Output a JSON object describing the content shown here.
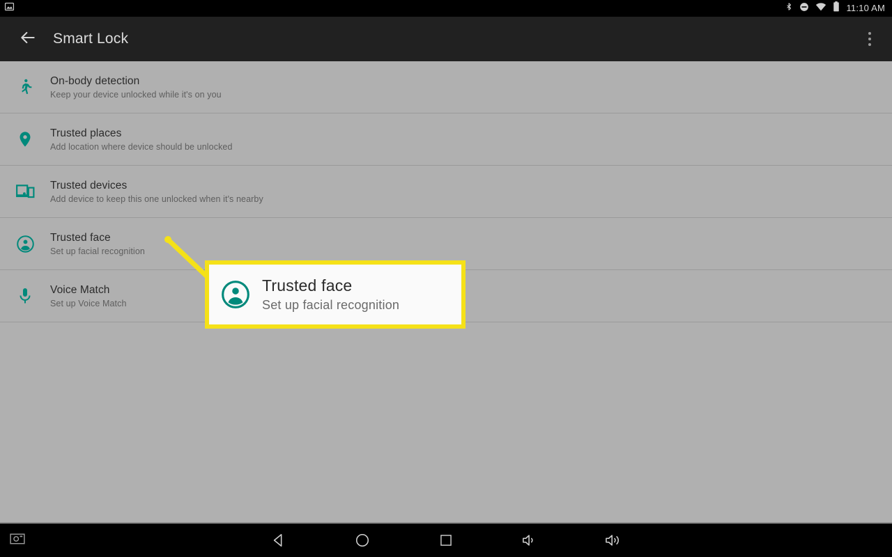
{
  "statusbar": {
    "notification_icon": "screenshot-image-icon",
    "icons": [
      "bluetooth-icon",
      "do-not-disturb-icon",
      "wifi-icon",
      "battery-icon"
    ],
    "time": "11:10 AM"
  },
  "actionbar": {
    "back_icon": "back-arrow-icon",
    "title": "Smart Lock",
    "overflow_icon": "overflow-menu-icon"
  },
  "list": {
    "items": [
      {
        "icon": "walking-person-icon",
        "title": "On-body detection",
        "subtitle": "Keep your device unlocked while it's on you"
      },
      {
        "icon": "location-pin-icon",
        "title": "Trusted places",
        "subtitle": "Add location where device should be unlocked"
      },
      {
        "icon": "devices-icon",
        "title": "Trusted devices",
        "subtitle": "Add device to keep this one unlocked when it's nearby"
      },
      {
        "icon": "face-account-circle-icon",
        "title": "Trusted face",
        "subtitle": "Set up facial recognition"
      },
      {
        "icon": "microphone-icon",
        "title": "Voice Match",
        "subtitle": "Set up Voice Match"
      }
    ]
  },
  "callout": {
    "icon": "face-account-circle-icon",
    "title": "Trusted face",
    "subtitle": "Set up facial recognition",
    "border_color": "#f5e118",
    "background_color": "#fafafa",
    "pointer_color": "#f5e118"
  },
  "navbar": {
    "screenshot_icon": "camera-screenshot-icon",
    "buttons": [
      {
        "icon": "back-triangle-icon"
      },
      {
        "icon": "home-circle-icon"
      },
      {
        "icon": "recents-square-icon"
      },
      {
        "icon": "volume-down-icon"
      },
      {
        "icon": "volume-up-icon"
      }
    ]
  },
  "colors": {
    "accent_green": "#00897b",
    "list_background": "#b0b0b0",
    "actionbar_background": "#212121",
    "system_bar_background": "#000000"
  }
}
